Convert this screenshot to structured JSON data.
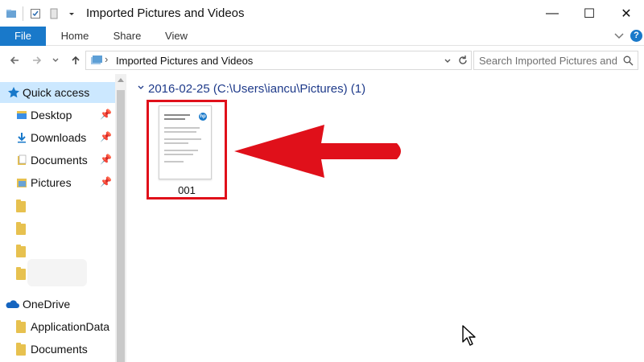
{
  "window": {
    "title": "Imported Pictures and Videos",
    "controls": {
      "minimize": "—",
      "maximize": "☐",
      "close": "✕"
    }
  },
  "ribbon": {
    "tabs": [
      {
        "label": "File"
      },
      {
        "label": "Home"
      },
      {
        "label": "Share"
      },
      {
        "label": "View"
      }
    ],
    "help_icon": "?"
  },
  "address": {
    "path": "Imported Pictures and Videos",
    "search_placeholder": "Search Imported Pictures and ..."
  },
  "nav": {
    "quick_access": "Quick access",
    "items": [
      {
        "label": "Desktop",
        "pinned": true
      },
      {
        "label": "Downloads",
        "pinned": true
      },
      {
        "label": "Documents",
        "pinned": true
      },
      {
        "label": "Pictures",
        "pinned": true
      }
    ],
    "onedrive": "OneDrive",
    "onedrive_items": [
      {
        "label": "ApplicationData"
      },
      {
        "label": "Documents"
      }
    ]
  },
  "content": {
    "group_header": "2016-02-25 (C:\\Users\\iancu\\Pictures) (1)",
    "items": [
      {
        "label": "001"
      }
    ]
  },
  "colors": {
    "accent": "#1979ca",
    "highlight": "#e0101a",
    "selection": "#cce8ff"
  }
}
